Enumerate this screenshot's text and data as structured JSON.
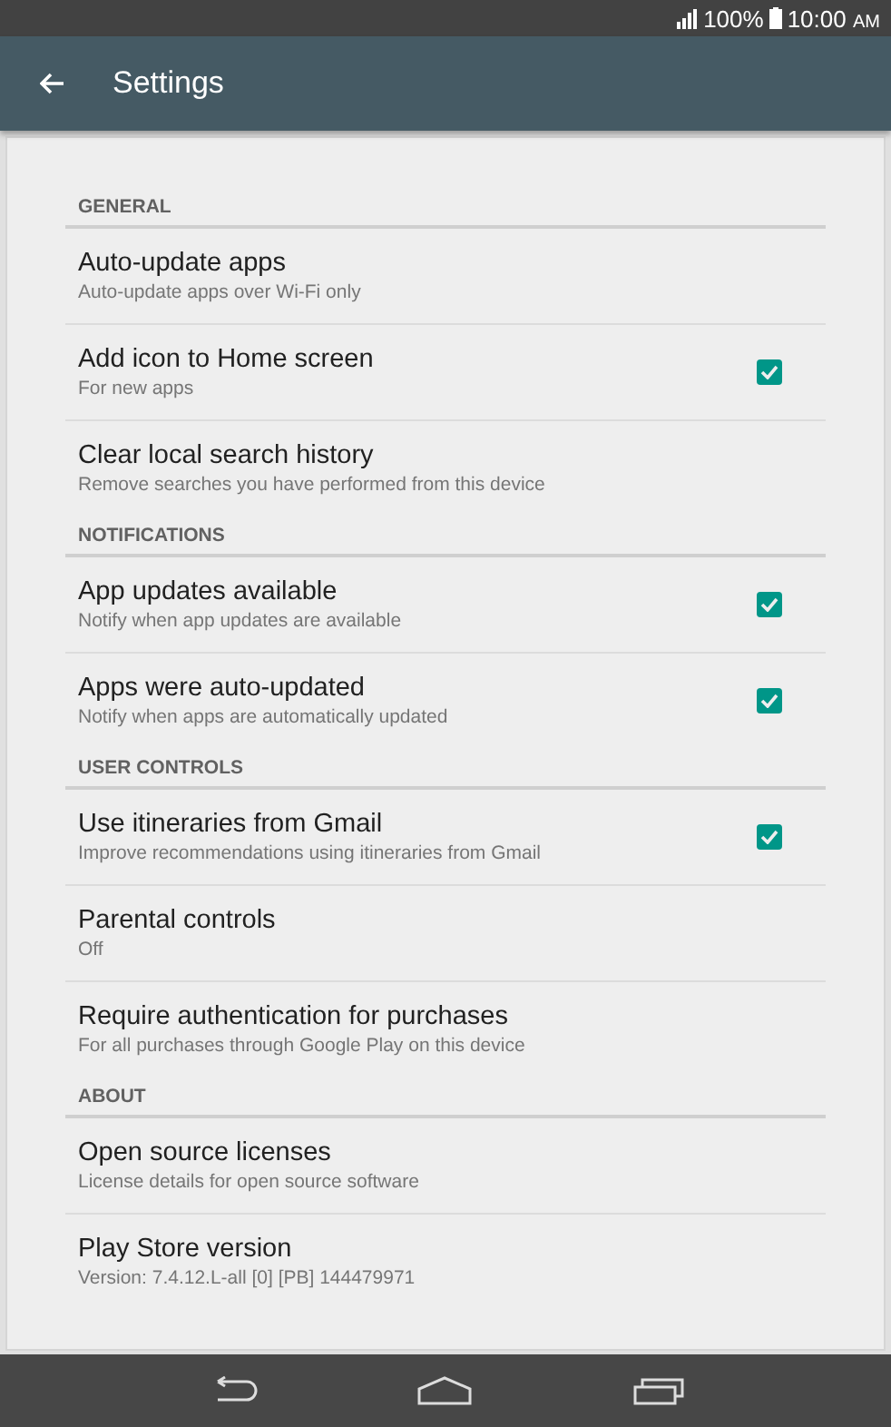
{
  "status_bar": {
    "battery": "100%",
    "time": "10:00",
    "time_suffix": "AM"
  },
  "app_bar": {
    "title": "Settings"
  },
  "sections": [
    {
      "header": "GENERAL",
      "items": [
        {
          "title": "Auto-update apps",
          "summary": "Auto-update apps over Wi-Fi only",
          "kind": "plain"
        },
        {
          "title": "Add icon to Home screen",
          "summary": "For new apps",
          "kind": "checkbox",
          "checked": true
        },
        {
          "title": "Clear local search history",
          "summary": "Remove searches you have performed from this device",
          "kind": "plain"
        }
      ]
    },
    {
      "header": "NOTIFICATIONS",
      "items": [
        {
          "title": "App updates available",
          "summary": "Notify when app updates are available",
          "kind": "checkbox",
          "checked": true
        },
        {
          "title": "Apps were auto-updated",
          "summary": "Notify when apps are automatically updated",
          "kind": "checkbox",
          "checked": true
        }
      ]
    },
    {
      "header": "USER CONTROLS",
      "items": [
        {
          "title": "Use itineraries from Gmail",
          "summary": "Improve recommendations using itineraries from Gmail",
          "kind": "checkbox",
          "checked": true
        },
        {
          "title": "Parental controls",
          "summary": "Off",
          "kind": "plain"
        },
        {
          "title": "Require authentication for purchases",
          "summary": "For all purchases through Google Play on this device",
          "kind": "plain"
        }
      ]
    },
    {
      "header": "ABOUT",
      "items": [
        {
          "title": "Open source licenses",
          "summary": "License details for open source software",
          "kind": "plain"
        },
        {
          "title": "Play Store version",
          "summary": "Version: 7.4.12.L-all [0] [PB] 144479971",
          "kind": "plain"
        }
      ]
    }
  ]
}
